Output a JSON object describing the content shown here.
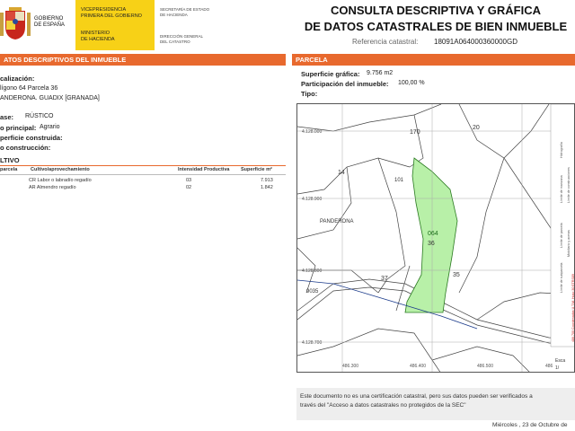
{
  "header": {
    "gov_line1": "GOBIERNO",
    "gov_line2": "DE ESPAÑA",
    "vp_line1": "VICEPRESIDENCIA",
    "vp_line2": "PRIMERA DEL GOBIERNO",
    "min_line1": "MINISTERIO",
    "min_line2": "DE HACIENDA",
    "sec_line1": "SECRETARÍA DE ESTADO",
    "sec_line2": "DE HACIENDA",
    "dir_line1": "DIRECCIÓN GENERAL",
    "dir_line2": "DEL CATASTRO",
    "title_line1": "CONSULTA DESCRIPTIVA Y GRÁFICA",
    "title_line2": "DE DATOS CATASTRALES DE BIEN INMUEBLE",
    "refcat_label": "Referencia catastral:",
    "refcat_value": "18091A064000360000GD"
  },
  "left": {
    "bar_title": "ATOS DESCRIPTIVOS DEL INMUEBLE",
    "loc_label": "calización:",
    "loc_line1": "lígono 64 Parcela 36",
    "loc_line2": "ANDERONA. GUADIX [GRANADA]",
    "clase_label": "ase:",
    "clase_value": "RÚSTICO",
    "uso_label": "o principal:",
    "uso_value": "Agrario",
    "sup_label": "perficie construida:",
    "anio_label": "o construcción:",
    "cultivo_title": "LTIVO",
    "table_headers": [
      "parcela",
      "Cultivo/aprovechamiento",
      "Intensidad Productiva",
      "Superficie m²"
    ],
    "rows": [
      {
        "cultivo": "CR Labor o labradío regadío",
        "intensidad": "03",
        "superficie": "7.913"
      },
      {
        "cultivo": "AR Almendro regadío",
        "intensidad": "02",
        "superficie": "1.842"
      }
    ]
  },
  "right": {
    "bar_title": "PARCELA",
    "sup_label": "Superficie gráfica:",
    "sup_value": "9.756 m2",
    "part_label": "Participación del inmueble:",
    "part_value": "100,00 %",
    "tipo_label": "Tipo:"
  },
  "map": {
    "labels": {
      "y1": "4.128.000",
      "y2": "4.128.900",
      "y3": "4.128.800",
      "y4": "4.128.700",
      "p170": "170",
      "p20": "20",
      "p14": "14",
      "p101": "101",
      "place": "PANDERONA",
      "p064": "064",
      "p36": "36",
      "p37": "37",
      "p35": "35",
      "p9035": "9035",
      "x1": "486.300",
      "x2": "486.400",
      "x3": "486.500",
      "x4": "486",
      "esc": "Esca",
      "esc2": "1/"
    },
    "parcel_color": "#b8f0a8"
  },
  "legend": {
    "l1": "Hidrografía",
    "l2": "Límite de manzana",
    "l3": "Límite de parcela",
    "l4": "Límite de subparcela",
    "l5": "Límite de construcciones",
    "l6": "Mobiliario y aceras",
    "coords": "486.700 Coordenadas U.T.M. Huso 30 ETRS89"
  },
  "footer": {
    "note_line1": "Este documento no es una certificación catastral, pero sus datos pueden ser verificados a",
    "note_line2": "través del \"Acceso a datos catastrales no protegidos de la SEC\"",
    "date": "Miércoles , 23 de Octubre de"
  }
}
